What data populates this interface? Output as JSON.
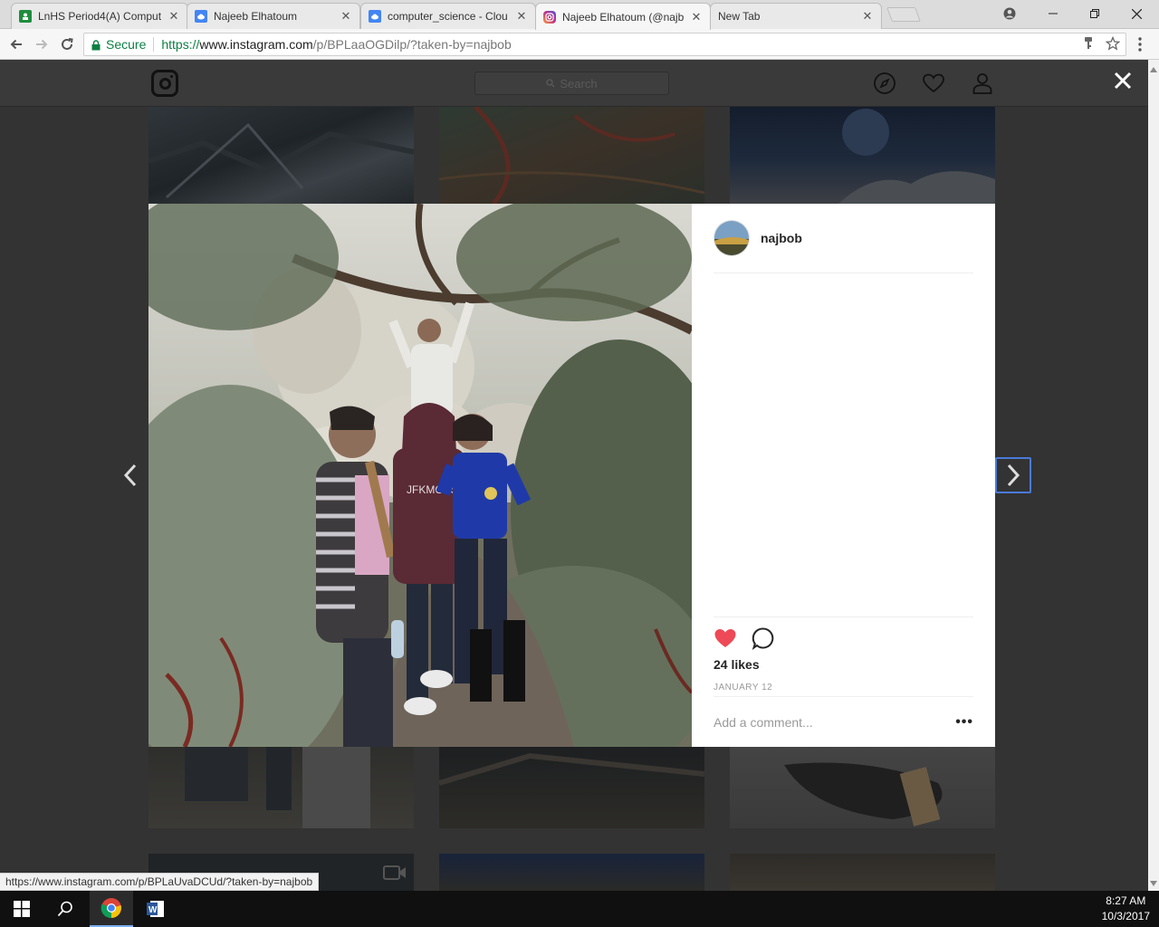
{
  "browser": {
    "tabs": [
      {
        "title": "LnHS Period4(A) Comput",
        "favicon": "classroom-icon",
        "color": "#1e8e3e"
      },
      {
        "title": "Najeeb Elhatoum",
        "favicon": "cloud-icon",
        "color": "#4285f4"
      },
      {
        "title": "computer_science - Clou",
        "favicon": "cloud-icon",
        "color": "#4285f4"
      },
      {
        "title": "Najeeb Elhatoum (@najb",
        "favicon": "instagram-icon",
        "color": "#c13584"
      },
      {
        "title": "New Tab",
        "favicon": "",
        "color": ""
      }
    ],
    "secure_label": "Secure",
    "url_scheme": "https://",
    "url_host": "www.instagram.com",
    "url_path": "/p/BPLaaOGDilp/?taken-by=najbob"
  },
  "instagram": {
    "search_placeholder": "Search",
    "post": {
      "username": "najbob",
      "likes": "24 likes",
      "date": "JANUARY 12",
      "comment_placeholder": "Add a comment...",
      "more": "•••",
      "liked_color": "#ed4956"
    }
  },
  "status_url": "https://www.instagram.com/p/BPLaUvaDCUd/?taken-by=najbob",
  "taskbar": {
    "time": "8:27 AM",
    "date": "10/3/2017"
  }
}
